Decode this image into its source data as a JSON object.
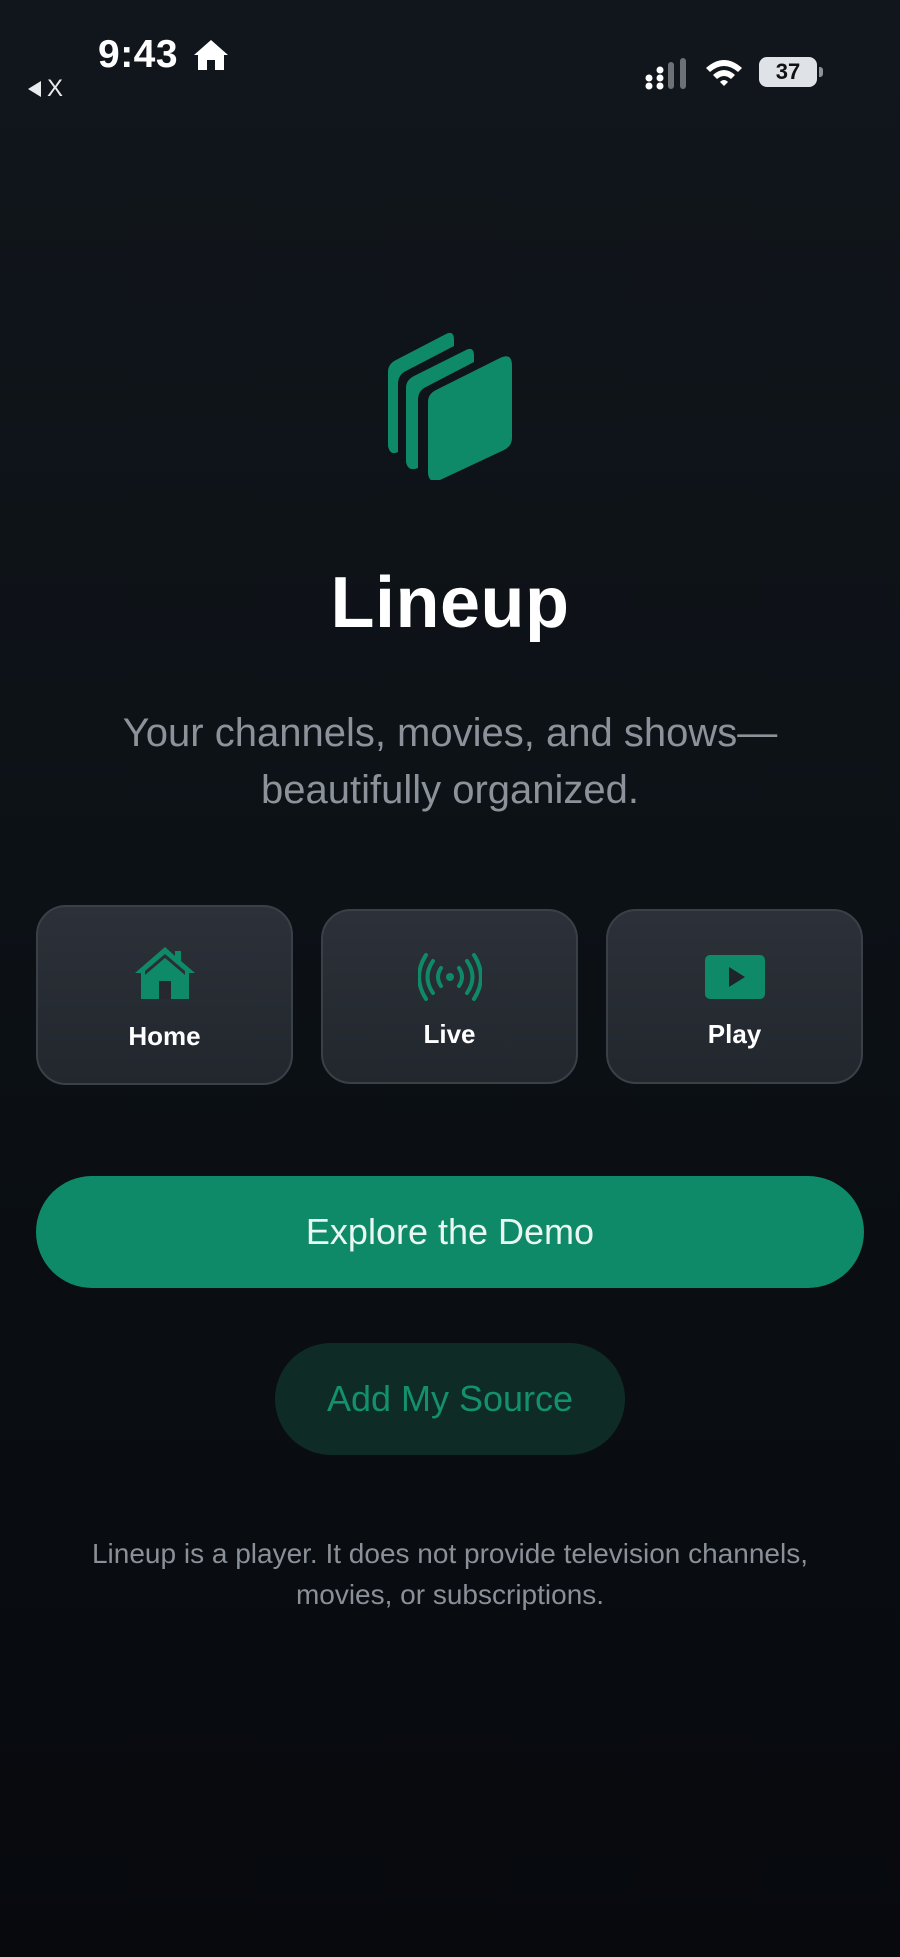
{
  "status_bar": {
    "time": "9:43",
    "back_label": "X",
    "battery_level": "37",
    "icons": [
      "home-icon",
      "signal-icon",
      "wifi-icon",
      "battery-icon"
    ]
  },
  "app": {
    "name": "Lineup",
    "tagline_line1": "Your channels, movies, and shows—",
    "tagline_line2": "beautifully organized.",
    "accent_color": "#0f8a68"
  },
  "features": [
    {
      "label": "Home",
      "icon": "home-icon"
    },
    {
      "label": "Live",
      "icon": "broadcast-icon"
    },
    {
      "label": "Play",
      "icon": "play-icon"
    }
  ],
  "actions": {
    "primary_label": "Explore the Demo",
    "secondary_label": "Add My Source"
  },
  "disclaimer": {
    "line1": "Lineup is a player. It does not provide television channels,",
    "line2": "movies, or subscriptions."
  }
}
